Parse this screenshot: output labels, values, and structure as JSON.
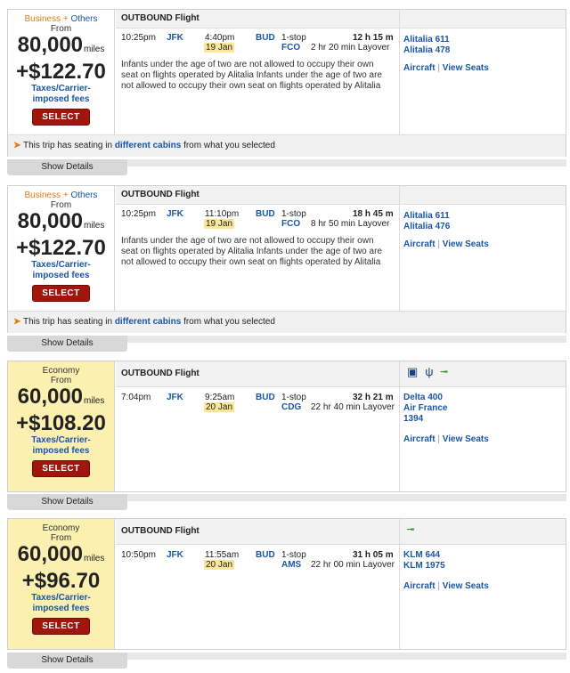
{
  "flights": [
    {
      "cabin": {
        "primary": "Business",
        "plus": " + ",
        "secondary": "Others"
      },
      "from": "From",
      "miles": "80,000",
      "miles_unit": "miles",
      "money": "+$122.70",
      "fees1": "Taxes/Carrier-",
      "fees2": "imposed fees",
      "select": "SELECT",
      "header": "OUTBOUND Flight",
      "dep_time": "10:25pm",
      "dep_code": "JFK",
      "arr_time": "4:40pm",
      "arr_date": "19 Jan",
      "arr_code": "BUD",
      "stops": "1-stop",
      "duration": "12 h 15 m",
      "layover_code": "FCO",
      "layover": "2 hr 20 min Layover",
      "note": [
        "Infants under the age of two are not allowed to occupy their own",
        "seat on flights operated by Alitalia Infants under the age of two are",
        "not allowed to occupy their own seat on flights operated by Alitalia"
      ],
      "airlines": [
        "Alitalia 611",
        "Alitalia 478"
      ],
      "aircraft": "Aircraft",
      "sep": "|",
      "view_seats": "View Seats",
      "warning": {
        "pre": "This trip has seating in ",
        "link": "different cabins",
        "post": " from what you selected"
      },
      "show_details": "Show Details"
    },
    {
      "cabin": {
        "primary": "Business",
        "plus": " + ",
        "secondary": "Others"
      },
      "from": "From",
      "miles": "80,000",
      "miles_unit": "miles",
      "money": "+$122.70",
      "fees1": "Taxes/Carrier-",
      "fees2": "imposed fees",
      "select": "SELECT",
      "header": "OUTBOUND Flight",
      "dep_time": "10:25pm",
      "dep_code": "JFK",
      "arr_time": "11:10pm",
      "arr_date": "19 Jan",
      "arr_code": "BUD",
      "stops": "1-stop",
      "duration": "18 h 45 m",
      "layover_code": "FCO",
      "layover": "8 hr 50 min Layover",
      "note": [
        "Infants under the age of two are not allowed to occupy their own",
        "seat on flights operated by Alitalia Infants under the age of two are",
        "not allowed to occupy their own seat on flights operated by Alitalia"
      ],
      "airlines": [
        "Alitalia 611",
        "Alitalia 476"
      ],
      "aircraft": "Aircraft",
      "sep": "|",
      "view_seats": "View Seats",
      "warning": {
        "pre": "This trip has seating in ",
        "link": "different cabins",
        "post": " from what you selected"
      },
      "show_details": "Show Details"
    },
    {
      "cabin": {
        "primary": "Economy"
      },
      "from": "From",
      "miles": "60,000",
      "miles_unit": "miles",
      "money": "+$108.20",
      "fees1": "Taxes/Carrier-",
      "fees2": "imposed fees",
      "select": "SELECT",
      "header": "OUTBOUND Flight",
      "icons": [
        "monitor-icon",
        "usb-power-icon",
        "seat-icon"
      ],
      "dep_time": "7:04pm",
      "dep_code": "JFK",
      "arr_time": "9:25am",
      "arr_date": "20 Jan",
      "arr_code": "BUD",
      "stops": "1-stop",
      "duration": "32 h 21 m",
      "layover_code": "CDG",
      "layover": "22 hr 40 min Layover",
      "airlines": [
        "Delta 400",
        "Air France",
        "1394"
      ],
      "aircraft": "Aircraft",
      "sep": "|",
      "view_seats": "View Seats",
      "show_details": "Show Details"
    },
    {
      "cabin": {
        "primary": "Economy"
      },
      "from": "From",
      "miles": "60,000",
      "miles_unit": "miles",
      "money": "+$96.70",
      "fees1": "Taxes/Carrier-",
      "fees2": "imposed fees",
      "select": "SELECT",
      "header": "OUTBOUND Flight",
      "icons": [
        "seat-icon"
      ],
      "dep_time": "10:50pm",
      "dep_code": "JFK",
      "arr_time": "11:55am",
      "arr_date": "20 Jan",
      "arr_code": "BUD",
      "stops": "1-stop",
      "duration": "31 h 05 m",
      "layover_code": "AMS",
      "layover": "22 hr 00 min Layover",
      "airlines": [
        "KLM 644",
        "KLM 1975"
      ],
      "aircraft": "Aircraft",
      "sep": "|",
      "view_seats": "View Seats",
      "show_details": "Show Details"
    }
  ],
  "colors": {
    "link": "#1a56a6",
    "select": "#a0150c",
    "economy_bg": "#fcf0b0",
    "date_bg": "#fbe79a",
    "accent": "#e37c11"
  }
}
